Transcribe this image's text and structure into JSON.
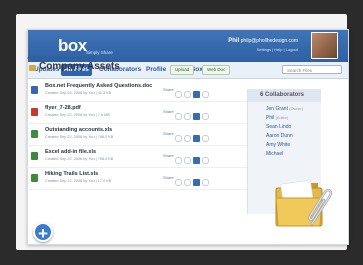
{
  "header": {
    "logo": "box",
    "tagline": "Simply Share",
    "user_name": "Phil",
    "user_email": "philp@phollhedesign.com",
    "user_links": "Settings | Help | Logout"
  },
  "nav": {
    "tabs": [
      "Updates",
      "All Files",
      "Collaborators",
      "Profile",
      "OpenBox"
    ],
    "active_tab": "All Files",
    "search_placeholder": "Search Files"
  },
  "folder": {
    "breadcrumb": "All Files » Company Assets Folder",
    "title": "Company Assets",
    "upload_label": "Upload",
    "webdoc_label": "Web Doc"
  },
  "files": [
    {
      "name": "Box.net Frequently Asked Questions.doc",
      "meta": "Created Sep 26, 2008 by You | 42.3 KB",
      "color": "#3d64b0"
    },
    {
      "name": "flyer_7-28.pdf",
      "meta": "Created Sep 22, 2008 by You | 7.6 MB",
      "color": "#c23a2e"
    },
    {
      "name": "Outstanding accounts.xls",
      "meta": "Created Sep 22, 2008 by You | 798.0 KB",
      "color": "#3f8a40"
    },
    {
      "name": "Excel add-in file.xls",
      "meta": "Created Sep 22, 2008 by You | 798.0 KB",
      "color": "#3f8a40"
    },
    {
      "name": "Hiking Trails List.xls",
      "meta": "Created Sep 22, 2008 by You | 17.0 KB",
      "color": "#3f8a40"
    }
  ],
  "share_label": "Share",
  "collaborators": {
    "header": "6 Collaborators",
    "people": [
      {
        "name": "Jen Grant",
        "note": "(Owner)"
      },
      {
        "name": "Phil",
        "note": "(Editor)"
      },
      {
        "name": "Sean Lindo",
        "note": ""
      },
      {
        "name": "Aaron Dunn",
        "note": ""
      },
      {
        "name": "Amy White",
        "note": ""
      },
      {
        "name": "Michael",
        "note": ""
      }
    ]
  },
  "add_button": "+"
}
